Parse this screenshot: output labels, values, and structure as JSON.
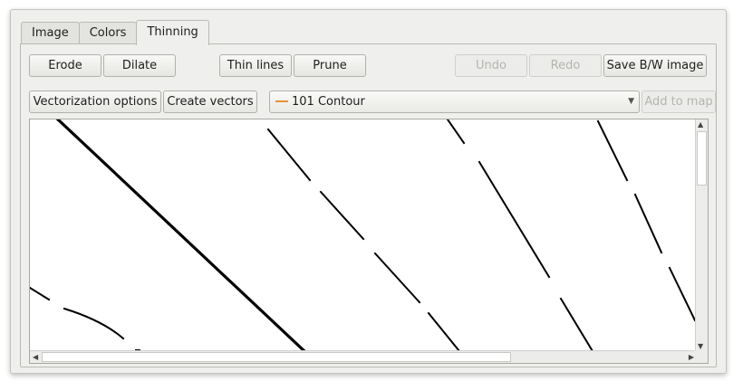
{
  "tabs": [
    {
      "label": "Image",
      "active": false
    },
    {
      "label": "Colors",
      "active": false
    },
    {
      "label": "Thinning",
      "active": true
    }
  ],
  "toolbar": {
    "erode": "Erode",
    "dilate": "Dilate",
    "thin_lines": "Thin lines",
    "prune": "Prune",
    "undo": "Undo",
    "redo": "Redo",
    "save_bw": "Save B/W image",
    "vectorization_options": "Vectorization options",
    "create_vectors": "Create vectors",
    "add_to_map": "Add to map"
  },
  "symbol_select": {
    "value": "101 Contour",
    "swatch_color": "#e8923a"
  }
}
